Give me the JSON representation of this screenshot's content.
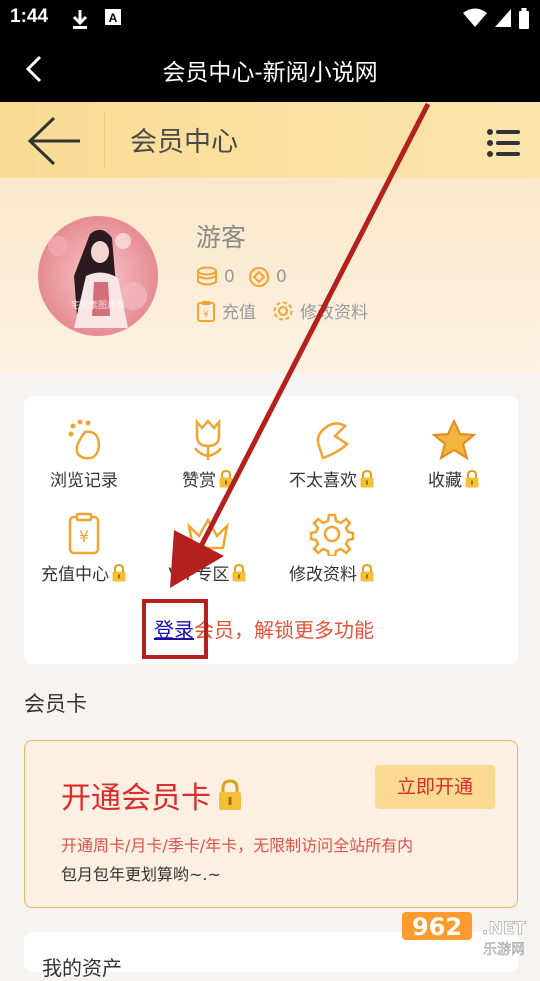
{
  "status": {
    "time": "1:44"
  },
  "titlebar": {
    "title": "会员中心-新阅小说网"
  },
  "header": {
    "title": "会员中心"
  },
  "profile": {
    "name": "游客",
    "coins": "0",
    "points": "0",
    "recharge_label": "充值",
    "edit_label": "修改资料",
    "avatar_watermark": "宅元素图片库"
  },
  "functions": [
    {
      "label": "浏览记录",
      "icon": "footprint-icon",
      "locked": false
    },
    {
      "label": "赞赏",
      "icon": "flower-icon",
      "locked": true
    },
    {
      "label": "不太喜欢",
      "icon": "dislike-icon",
      "locked": true
    },
    {
      "label": "收藏",
      "icon": "star-icon",
      "locked": true
    },
    {
      "label": "充值中心",
      "icon": "recharge-icon",
      "locked": true
    },
    {
      "label": "VIP专区",
      "icon": "crown-icon",
      "locked": true
    },
    {
      "label": "修改资料",
      "icon": "gear-icon",
      "locked": true
    }
  ],
  "login_prompt": {
    "link": "登录",
    "rest": "会员，解锁更多功能"
  },
  "member_card": {
    "section_title": "会员卡",
    "title": "开通会员卡",
    "button": "立即开通",
    "desc_line1": "开通周卡/月卡/季卡/年卡，无限制访问全站所有内",
    "desc_line2": "包月包年更划算哟~.~"
  },
  "next_section": {
    "title": "我的资产"
  },
  "watermark": {
    "brand": "962",
    "net": ".NET",
    "site": "乐游网"
  },
  "colors": {
    "accent_red": "#d92c2c",
    "gold": "#f0a431",
    "annotation_red": "#b3201d",
    "link_blue": "#1a0dab"
  }
}
